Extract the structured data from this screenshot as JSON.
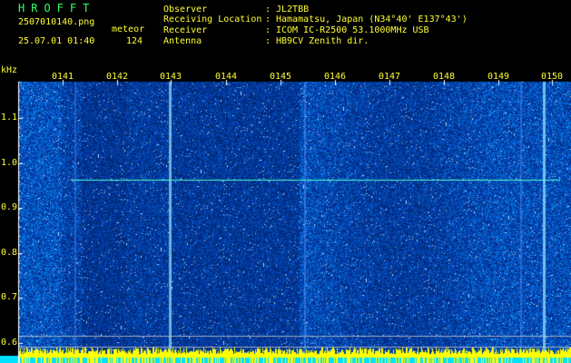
{
  "header": {
    "brand": "HROFFT",
    "filename": "2507010140.png",
    "timestamp": "25.07.01 01:40",
    "meteor_label": "meteor",
    "meteor_count": "124",
    "fields": [
      {
        "key": "Observer",
        "sep": ":",
        "value": "JL2TBB"
      },
      {
        "key": "Receiving Location",
        "sep": ":",
        "value": "Hamamatsu, Japan (N34°40' E137°43')"
      },
      {
        "key": "Receiver",
        "sep": ":",
        "value": "ICOM IC-R2500 53.1000MHz USB"
      },
      {
        "key": "Antenna",
        "sep": ":",
        "value": "HB9CV Zenith dir."
      }
    ]
  },
  "axis": {
    "y_unit": "kHz",
    "y_ticks": [
      "1.1",
      "1.0",
      "0.9",
      "0.8",
      "0.7",
      "0.6"
    ],
    "x_ticks": [
      "0141",
      "0142",
      "0143",
      "0144",
      "0145",
      "0146",
      "0147",
      "0148",
      "0149",
      "0150"
    ]
  },
  "colors": {
    "background": "#000000",
    "text": "#ffff33",
    "brand": "#33ff66",
    "noise_dark": "#000a6e",
    "noise_light": "#3a5cff",
    "trace": "#4fffd0"
  }
}
